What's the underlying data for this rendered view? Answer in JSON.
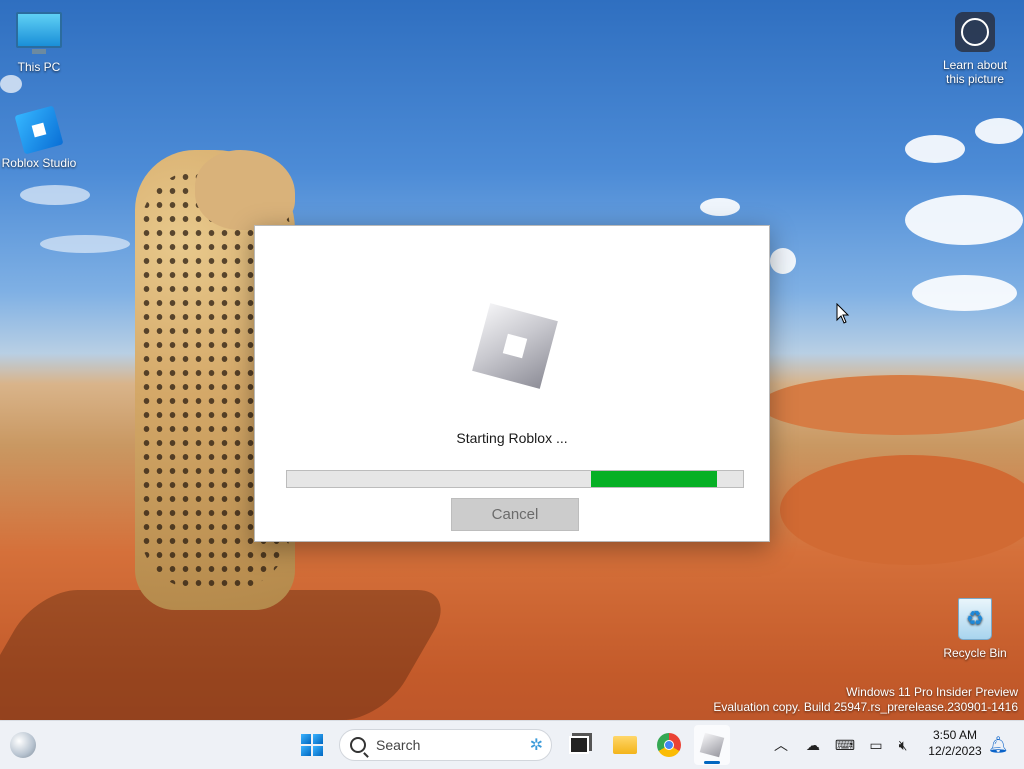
{
  "desktop": {
    "icons": {
      "this_pc": "This PC",
      "roblox_studio": "Roblox Studio",
      "learn": "Learn about\nthis picture",
      "learn_line1": "Learn about",
      "learn_line2": "this picture",
      "recycle_bin": "Recycle Bin"
    },
    "watermark": {
      "line1": "Windows 11 Pro Insider Preview",
      "line2": "Evaluation copy. Build 25947.rs_prerelease.230901-1416"
    }
  },
  "dialog": {
    "status": "Starting Roblox ...",
    "progress_percent": 95,
    "cancel_label": "Cancel"
  },
  "taskbar": {
    "search_placeholder": "Search",
    "pinned": [
      "start-icon",
      "search-icon",
      "task-view-icon",
      "file-explorer-icon",
      "chrome-icon",
      "roblox-icon"
    ],
    "tray_icons": [
      "chevron-up-icon",
      "onedrive-icon",
      "keyboard-icon",
      "network-icon",
      "volume-muted-icon"
    ],
    "time": "3:50 AM",
    "date": "12/2/2023"
  },
  "colors": {
    "progress_fill": "#06b025",
    "accent": "#0067c0"
  }
}
